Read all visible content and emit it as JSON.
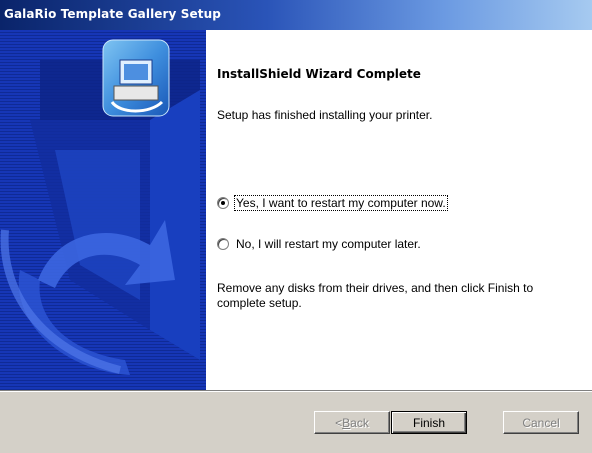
{
  "window": {
    "title": "GalaRio Template Gallery Setup"
  },
  "main": {
    "heading": "InstallShield Wizard Complete",
    "message": "Setup has finished installing your printer.",
    "options": [
      {
        "label": "Yes, I want to restart my computer now.",
        "checked": true
      },
      {
        "label": "No, I will restart my computer later.",
        "checked": false
      }
    ],
    "instructions": "Remove any disks from their drives, and then click Finish to complete setup."
  },
  "buttons": {
    "back": "< Back",
    "finish": "Finish",
    "cancel": "Cancel"
  },
  "colors": {
    "title_bar": "#0a246a",
    "banner": "#1636b6",
    "content_bg": "#ffffff",
    "dialog_bg": "#d4d0c8"
  }
}
